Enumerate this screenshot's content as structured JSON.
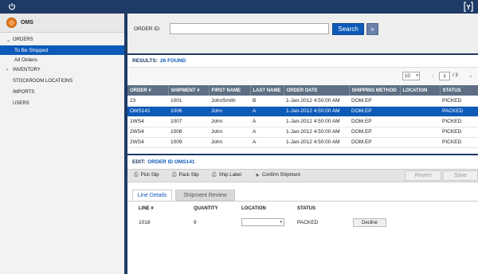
{
  "topbar": {
    "power_icon": "power-icon",
    "logo_icon": "app-logo-icon"
  },
  "sidebar": {
    "app_title": "OMS",
    "items": [
      {
        "label": "ORDERS",
        "expanded": true
      },
      {
        "label": "INVENTORY",
        "expanded": false
      },
      {
        "label": "STOCKROOM LOCATIONS"
      },
      {
        "label": "IMPORTS"
      },
      {
        "label": "USERS"
      }
    ],
    "order_subitems": [
      {
        "label": "To Be Shipped",
        "active": true
      },
      {
        "label": "All Orders",
        "active": false
      }
    ]
  },
  "search": {
    "label": "ORDER ID:",
    "value": "",
    "button": "Search"
  },
  "results": {
    "label": "RESULTS:",
    "count": "26 FOUND",
    "page_size": "10",
    "page": "1",
    "page_total": "/ 3",
    "columns": [
      "ORDER #",
      "SHIPMENT #",
      "FIRST NAME",
      "LAST NAME",
      "ORDER DATE",
      "SHIPPING METHOD",
      "LOCATION",
      "STATUS"
    ],
    "rows": [
      [
        "23",
        "1001",
        "JohnSmith",
        "B",
        "1-Jan-2012 4:50:00 AM",
        "DOM.EP",
        "",
        "PICKED"
      ],
      [
        "OMS141",
        "1006",
        "John",
        "A",
        "1-Jan-2012 4:50:00 AM",
        "DOM.EP",
        "",
        "PACKED"
      ],
      [
        "1WS4",
        "1007",
        "John",
        "A",
        "1-Jan-2012 4:50:00 AM",
        "DOM.EP",
        "",
        "PICKED"
      ],
      [
        "2WS4",
        "1008",
        "John",
        "A",
        "1-Jan-2012 4:50:00 AM",
        "DOM.EP",
        "",
        "PICKED"
      ],
      [
        "2WS4",
        "1009",
        "John",
        "A",
        "1-Jan-2012 4:50:00 AM",
        "DOM.EP",
        "",
        "PICKED"
      ]
    ],
    "selected_row": 1
  },
  "edit": {
    "label": "EDIT:",
    "order_ref": "ORDER ID OMS141",
    "actions": [
      "Pick Slip",
      "Pack Slip",
      "Ship Label",
      "Confirm Shipment"
    ],
    "revert": "Revert",
    "save": "Save",
    "tabs": [
      "Line Details",
      "Shipment Review"
    ],
    "line_columns": [
      "LINE #",
      "QUANTITY",
      "LOCATION",
      "STATUS"
    ],
    "line": {
      "line_no": "1018",
      "quantity": "9",
      "location": "",
      "status": "PACKED",
      "action": "Decline"
    }
  },
  "colors": {
    "brand": "#1e3a66",
    "accent": "#0d5ab8",
    "oms_badge": "#e77d1e"
  }
}
